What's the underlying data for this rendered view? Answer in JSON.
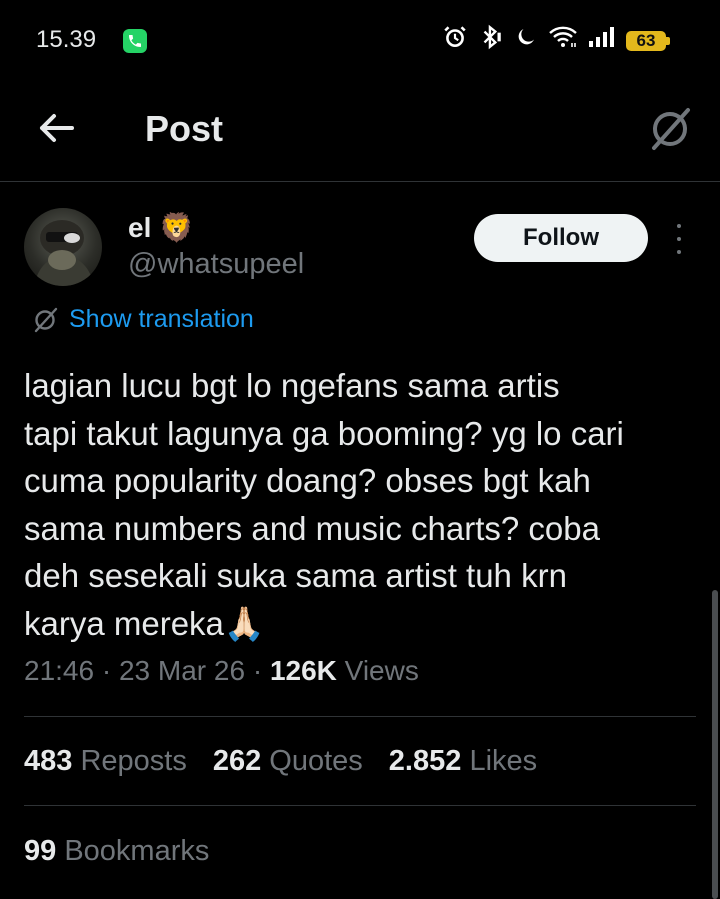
{
  "status_bar": {
    "time": "15.39",
    "battery": "63",
    "icons": [
      "call-icon",
      "alarm-icon",
      "bluetooth-icon",
      "vibrate-icon",
      "dnd-moon-icon",
      "wifi-icon",
      "signal-icon",
      "battery-icon"
    ]
  },
  "header": {
    "title": "Post",
    "back_icon": "arrow-left-icon",
    "right_icon": "grok-icon"
  },
  "author": {
    "display_name": "el",
    "emoji": "🦁",
    "handle": "@whatsupeel",
    "follow_label": "Follow"
  },
  "translate": {
    "label": "Show translation"
  },
  "post": {
    "text": "lagian lucu bgt lo ngefans sama artis\ntapi takut lagunya ga booming? yg lo cari\ncuma popularity doang? obses bgt kah\nsama numbers and music charts? coba\ndeh sesekali suka sama artist tuh krn\nkarya mereka🙏🏻",
    "time": "21:46",
    "date": "23 Mar 26",
    "views_count": "126K",
    "views_label": "Views"
  },
  "stats": {
    "reposts_count": "483",
    "reposts_label": "Reposts",
    "quotes_count": "262",
    "quotes_label": "Quotes",
    "likes_count": "2.852",
    "likes_label": "Likes",
    "bookmarks_count": "99",
    "bookmarks_label": "Bookmarks"
  },
  "colors": {
    "background": "#000000",
    "text": "#e7e9ea",
    "muted": "#71767b",
    "link": "#1d9bf0",
    "battery": "#e3b81c",
    "call": "#25d366"
  }
}
